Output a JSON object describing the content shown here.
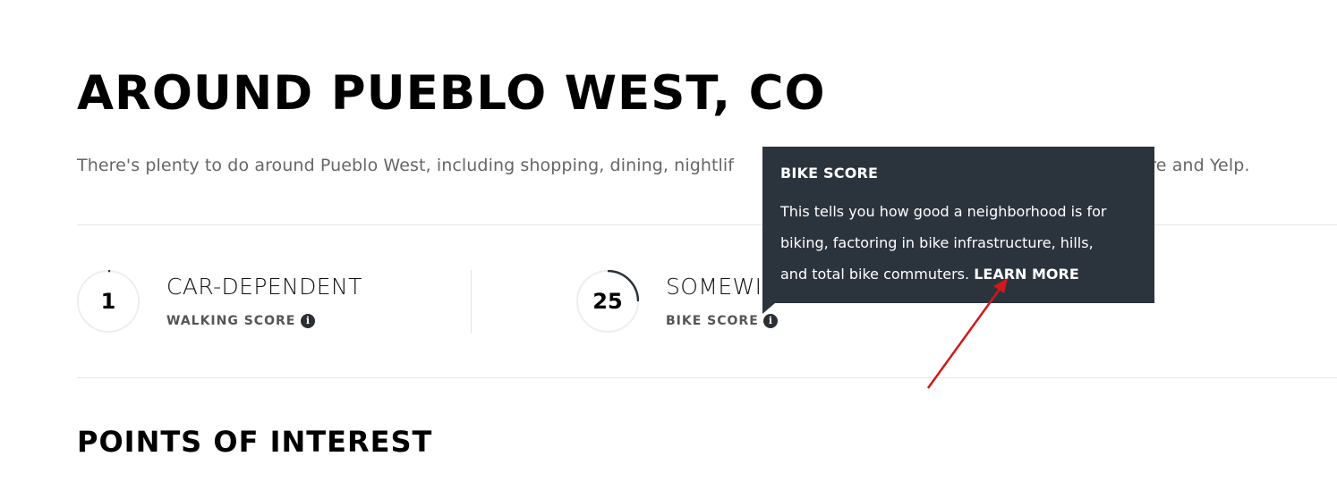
{
  "page": {
    "title": "AROUND PUEBLO WEST, CO",
    "description": "There's plenty to do around Pueblo West, including shopping, dining, nightlife, and more. Data provided by Walk Score and Yelp.",
    "description_visible_head": "There's plenty to do around Pueblo West, including shopping, dining, nightlif",
    "description_visible_tail": "core and Yelp."
  },
  "scores": [
    {
      "value": "1",
      "title": "CAR-DEPENDENT",
      "label": "WALKING SCORE",
      "progress": 0.01,
      "info_icon": "info-icon"
    },
    {
      "value": "25",
      "title": "SOMEWHAT BIKEABLE",
      "title_visible": "SOMEWI",
      "label": "BIKE SCORE",
      "progress": 0.25,
      "info_icon": "info-icon"
    }
  ],
  "tooltip": {
    "title": "BIKE SCORE",
    "body_lines": [
      "This tells you how good a neighborhood is for",
      "biking, factoring in bike infrastructure, hills,",
      "and total bike commuters."
    ],
    "link_label": "LEARN MORE"
  },
  "poi": {
    "title": "POINTS OF INTEREST"
  },
  "colors": {
    "tooltip_bg": "#2b333d",
    "ring_track": "#eeeeee",
    "ring_fill": "#2b333d",
    "annotation_arrow": "#d0191a"
  }
}
